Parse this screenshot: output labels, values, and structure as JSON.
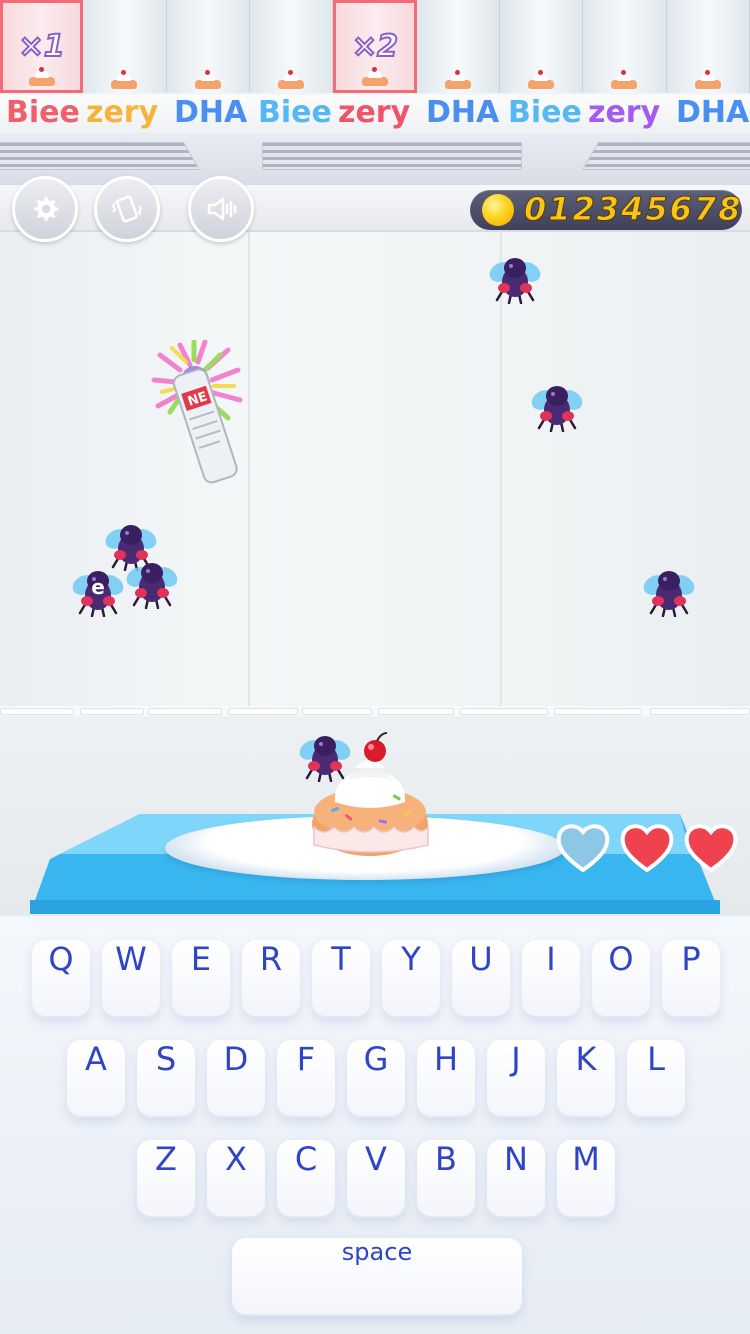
{
  "reward_strip": {
    "multipliers": [
      "×1",
      "×2"
    ],
    "highlighted_cells": [
      0,
      4
    ],
    "cell_count": 9
  },
  "brand_banner": {
    "words": [
      {
        "text": "Biee",
        "color": "#f0606c"
      },
      {
        "text": "zery",
        "color": "#f7b43a"
      },
      {
        "text": "DHA",
        "color": "#4a8ff0"
      },
      {
        "text": "Biee",
        "color": "#55b8f5"
      },
      {
        "text": "zery",
        "color": "#f05468"
      },
      {
        "text": "DHA",
        "color": "#4a8ff0"
      },
      {
        "text": "Biee",
        "color": "#55b8f5"
      },
      {
        "text": "zery",
        "color": "#a45cf0"
      },
      {
        "text": "DHA",
        "color": "#4a8ff0"
      }
    ]
  },
  "hud": {
    "settings_icon": "gear-icon",
    "vibration_icon": "phone-vibrate-icon",
    "sound_icon": "speaker-icon",
    "coins": "012345678"
  },
  "flies": [
    {
      "letter": ""
    },
    {
      "letter": ""
    },
    {
      "letter": ""
    },
    {
      "letter": ""
    },
    {
      "letter": "e"
    },
    {
      "letter": ""
    },
    {
      "letter": ""
    }
  ],
  "lives": {
    "total": 3,
    "remaining": 2
  },
  "keyboard": {
    "row1": [
      "Q",
      "W",
      "E",
      "R",
      "T",
      "Y",
      "U",
      "I",
      "O",
      "P"
    ],
    "row2": [
      "A",
      "S",
      "D",
      "F",
      "G",
      "H",
      "J",
      "K",
      "L"
    ],
    "row3": [
      "Z",
      "X",
      "C",
      "V",
      "B",
      "N",
      "M"
    ],
    "space_label": "space"
  },
  "colors": {
    "key_text": "#2f44c6",
    "coin_text": "#f7c51a",
    "heart_full": "#f0424e",
    "heart_empty": "#8ec7e6",
    "table": "#39b6f0"
  }
}
